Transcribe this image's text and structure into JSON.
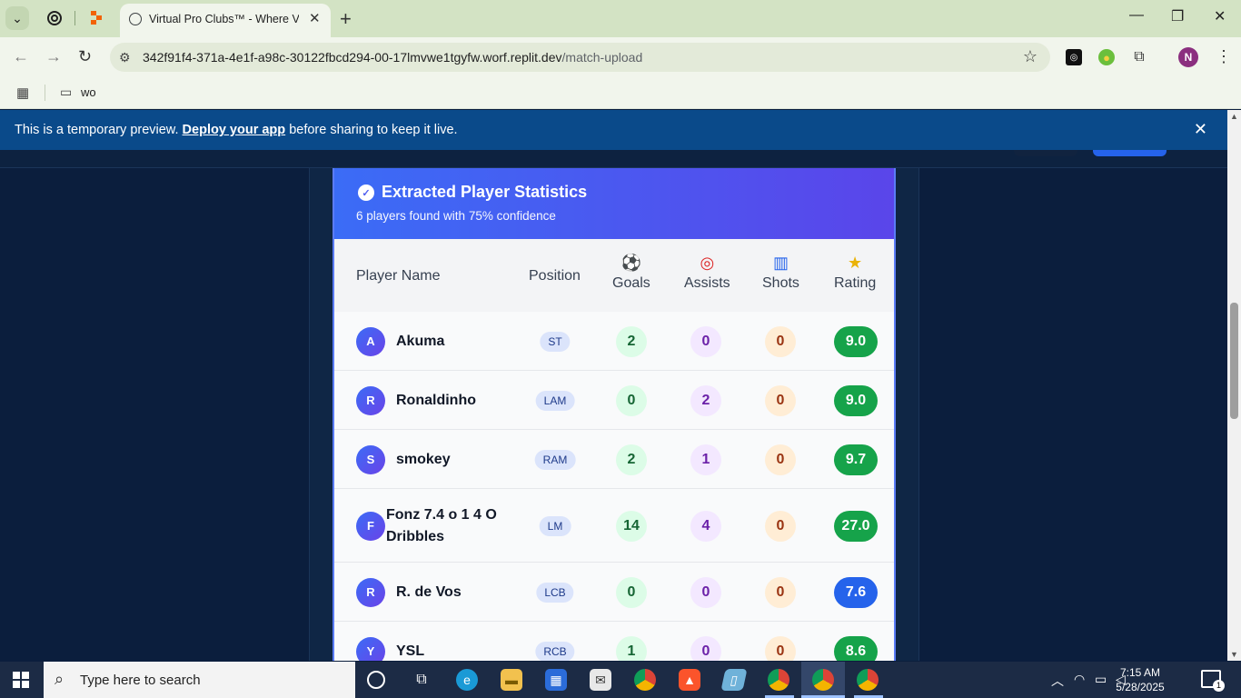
{
  "browser": {
    "tab_title": "Virtual Pro Clubs™ - Where Virtu",
    "url_host": "342f91f4-371a-4e1f-a98c-30122fbcd294-00-17lmvwe1tgyfw.worf.replit.dev",
    "url_path": "/match-upload",
    "bookmark_folder": "wo",
    "profile_initial": "N"
  },
  "banner": {
    "prefix": "This is a temporary preview.",
    "link": "Deploy your app",
    "suffix": "before sharing to keep it live."
  },
  "card": {
    "title": "Extracted Player Statistics",
    "subtitle": "6 players found with 75% confidence",
    "columns": {
      "player": "Player Name",
      "position": "Position",
      "goals": "Goals",
      "assists": "Assists",
      "shots": "Shots",
      "rating": "Rating"
    },
    "players": [
      {
        "initial": "A",
        "name": "Akuma",
        "position": "ST",
        "goals": "2",
        "assists": "0",
        "shots": "0",
        "rating": "9.0",
        "rating_color": "#16a34a"
      },
      {
        "initial": "R",
        "name": "Ronaldinho",
        "position": "LAM",
        "goals": "0",
        "assists": "2",
        "shots": "0",
        "rating": "9.0",
        "rating_color": "#16a34a"
      },
      {
        "initial": "S",
        "name": "smokey",
        "position": "RAM",
        "goals": "2",
        "assists": "1",
        "shots": "0",
        "rating": "9.7",
        "rating_color": "#16a34a"
      },
      {
        "initial": "F",
        "name": "Fonz 7.4 o 1 4 O Dribbles",
        "position": "LM",
        "goals": "14",
        "assists": "4",
        "shots": "0",
        "rating": "27.0",
        "rating_color": "#16a34a"
      },
      {
        "initial": "R",
        "name": "R. de Vos",
        "position": "LCB",
        "goals": "0",
        "assists": "0",
        "shots": "0",
        "rating": "7.6",
        "rating_color": "#2563eb"
      },
      {
        "initial": "Y",
        "name": "YSL",
        "position": "RCB",
        "goals": "1",
        "assists": "0",
        "shots": "0",
        "rating": "8.6",
        "rating_color": "#16a34a"
      }
    ]
  },
  "taskbar": {
    "search_placeholder": "Type here to search",
    "time": "7:15 AM",
    "date": "5/28/2025",
    "notifications": "1"
  }
}
